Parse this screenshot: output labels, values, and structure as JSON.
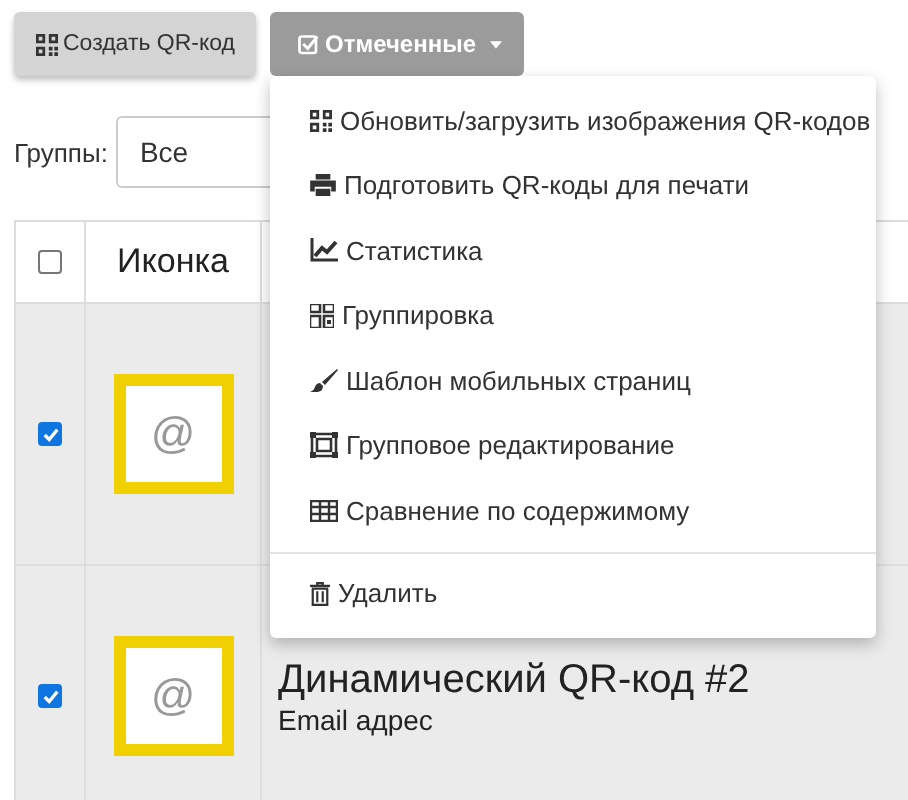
{
  "toolbar": {
    "create_button": {
      "label": "Создать QR-код"
    },
    "selected_button": {
      "label": "Отмеченные",
      "expanded": true
    }
  },
  "groups": {
    "label": "Группы:",
    "value": "Все"
  },
  "table": {
    "select_all_checked": false,
    "columns": [
      "Иконка"
    ],
    "rows": [
      {
        "selected": true,
        "icon_text": "@"
      },
      {
        "selected": true,
        "icon_text": "@",
        "title": "Динамический QR-код #2",
        "subtitle": "Email адрес"
      }
    ]
  },
  "menu": {
    "items": [
      {
        "kind": "qr",
        "label": "Обновить/загрузить изображения QR-кодов"
      },
      {
        "kind": "print",
        "label": "Подготовить QR-коды для печати"
      },
      {
        "kind": "chart",
        "label": "Статистика"
      },
      {
        "kind": "group",
        "label": "Группировка"
      },
      {
        "kind": "brush",
        "label": "Шаблон мобильных страниц"
      },
      {
        "kind": "edit",
        "label": "Групповое редактирование"
      },
      {
        "kind": "table",
        "label": "Сравнение по содержимому"
      }
    ],
    "footer_items": [
      {
        "kind": "trash",
        "label": "Удалить"
      }
    ]
  }
}
